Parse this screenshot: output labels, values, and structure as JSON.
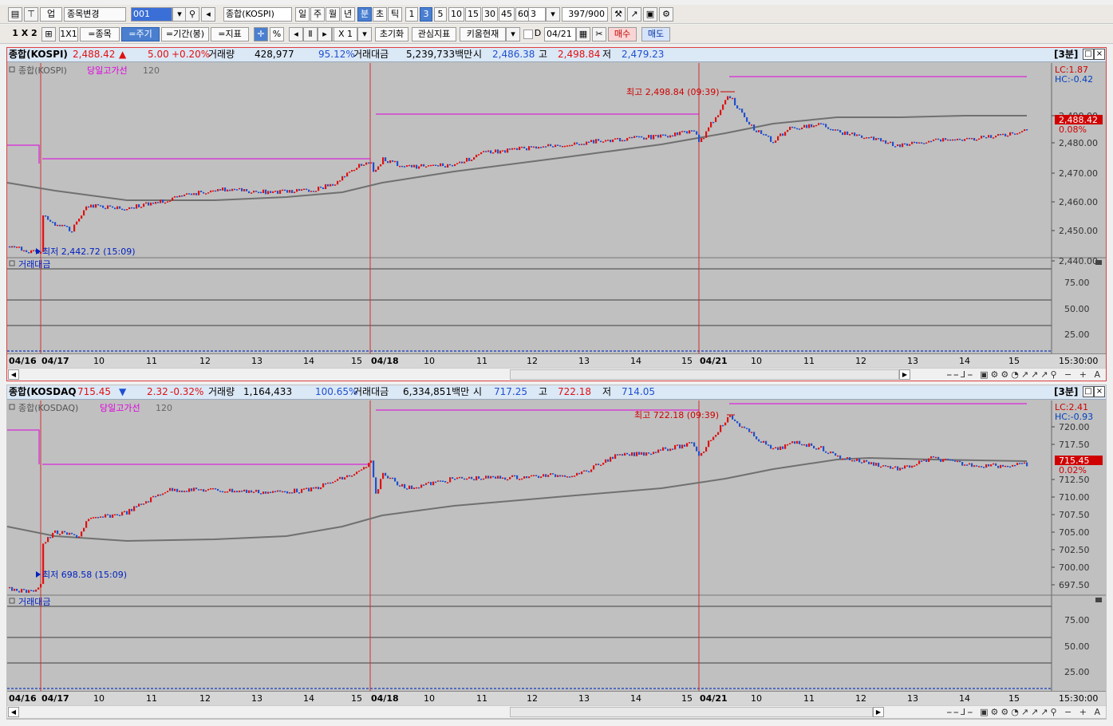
{
  "toolbar1": {
    "market": "업",
    "change_label": "종목변경",
    "code": "001",
    "stock_name": "종합(KOSPI)",
    "periods": [
      "일",
      "주",
      "월",
      "년",
      "분",
      "초",
      "틱"
    ],
    "minutes": [
      "1",
      "3",
      "5",
      "10",
      "15",
      "30",
      "45",
      "60"
    ],
    "interval": "3",
    "count": "397/900"
  },
  "toolbar2": {
    "layout": "1 X 2",
    "layout_1x1": "1X1",
    "btn_stock": "=종목",
    "btn_period": "=주기",
    "btn_range": "=기간(봉)",
    "btn_indicator": "=지표",
    "pct": "%",
    "zoom": "X 1",
    "btn_reset": "초기화",
    "btn_watch": "관심지표",
    "btn_kiwoom": "키움현재",
    "date_chk": "D",
    "date": "04/21",
    "btn_buy": "매수",
    "btn_sell": "매도"
  },
  "panels": [
    {
      "name": "종합(KOSPI)",
      "price": "2,488.42",
      "arrow": "▲",
      "change": "5.00",
      "change_pct": "+0.20%",
      "vol_label": "거래량",
      "volume": "428,977",
      "vol_pct": "95.12%",
      "amt_label": "거래대금",
      "amount": "5,239,733백만",
      "open_label": "시",
      "open": "2,486.38",
      "high_label": "고",
      "high": "2,498.84",
      "low_label": "저",
      "low": "2,479.23",
      "interval_tag": "[3분]",
      "legend_main": "종합(KOSPI)",
      "legend_line": "당일고가선",
      "legend_ma": "120",
      "sub_label": "거래대금",
      "hi_note": "최고 2,498.84 (09:39)",
      "lo_note": "최저 2,442.72 (15:09)",
      "lc": "LC:1.87",
      "hc": "HC:-0.42",
      "last_tag": "2,488.42",
      "last_pct": "0.08%",
      "y_ticks": [
        "2,490.00",
        "2,480.00",
        "2,470.00",
        "2,460.00",
        "2,450.00",
        "2,440.00"
      ],
      "sub_ticks": [
        "75.00",
        "50.00",
        "25.00"
      ],
      "x_labels": [
        "04/16",
        "04/17",
        "10",
        "11",
        "12",
        "13",
        "14",
        "15",
        "04/18",
        "10",
        "11",
        "12",
        "13",
        "14",
        "15",
        "04/21",
        "10",
        "11",
        "12",
        "13",
        "14",
        "15"
      ],
      "time": "15:30:00"
    },
    {
      "name": "종합(KOSDAQ",
      "price": "715.45",
      "arrow": "▼",
      "change": "2.32",
      "change_pct": "-0.32%",
      "vol_label": "거래량",
      "volume": "1,164,433",
      "vol_pct": "100.65%",
      "amt_label": "거래대금",
      "amount": "6,334,851백만",
      "open_label": "시",
      "open": "717.25",
      "high_label": "고",
      "high": "722.18",
      "low_label": "저",
      "low": "714.05",
      "interval_tag": "[3분]",
      "legend_main": "종합(KOSDAQ)",
      "legend_line": "당일고가선",
      "legend_ma": "120",
      "sub_label": "거래대금",
      "hi_note": "최고 722.18 (09:39)",
      "lo_note": "최저 698.58 (15:09)",
      "lc": "LC:2.41",
      "hc": "HC:-0.93",
      "last_tag": "715.45",
      "last_pct": "0.02%",
      "y_ticks": [
        "720.00",
        "717.50",
        "712.50",
        "710.00",
        "707.50",
        "705.00",
        "702.50",
        "700.00",
        "697.50"
      ],
      "sub_ticks": [
        "75.00",
        "50.00",
        "25.00"
      ],
      "x_labels": [
        "04/16",
        "04/17",
        "10",
        "11",
        "12",
        "13",
        "14",
        "15",
        "04/18",
        "10",
        "11",
        "12",
        "13",
        "14",
        "15",
        "04/21",
        "10",
        "11",
        "12",
        "13",
        "14",
        "15"
      ],
      "time": "15:30:00"
    }
  ],
  "colors": {
    "up": "#e01010",
    "down": "#1e50d0",
    "ma": "#707070",
    "high_line": "#e000e0",
    "vline": "#d03030",
    "bg": "#c0c0c0",
    "head_bg": "#dbe8f6"
  }
}
